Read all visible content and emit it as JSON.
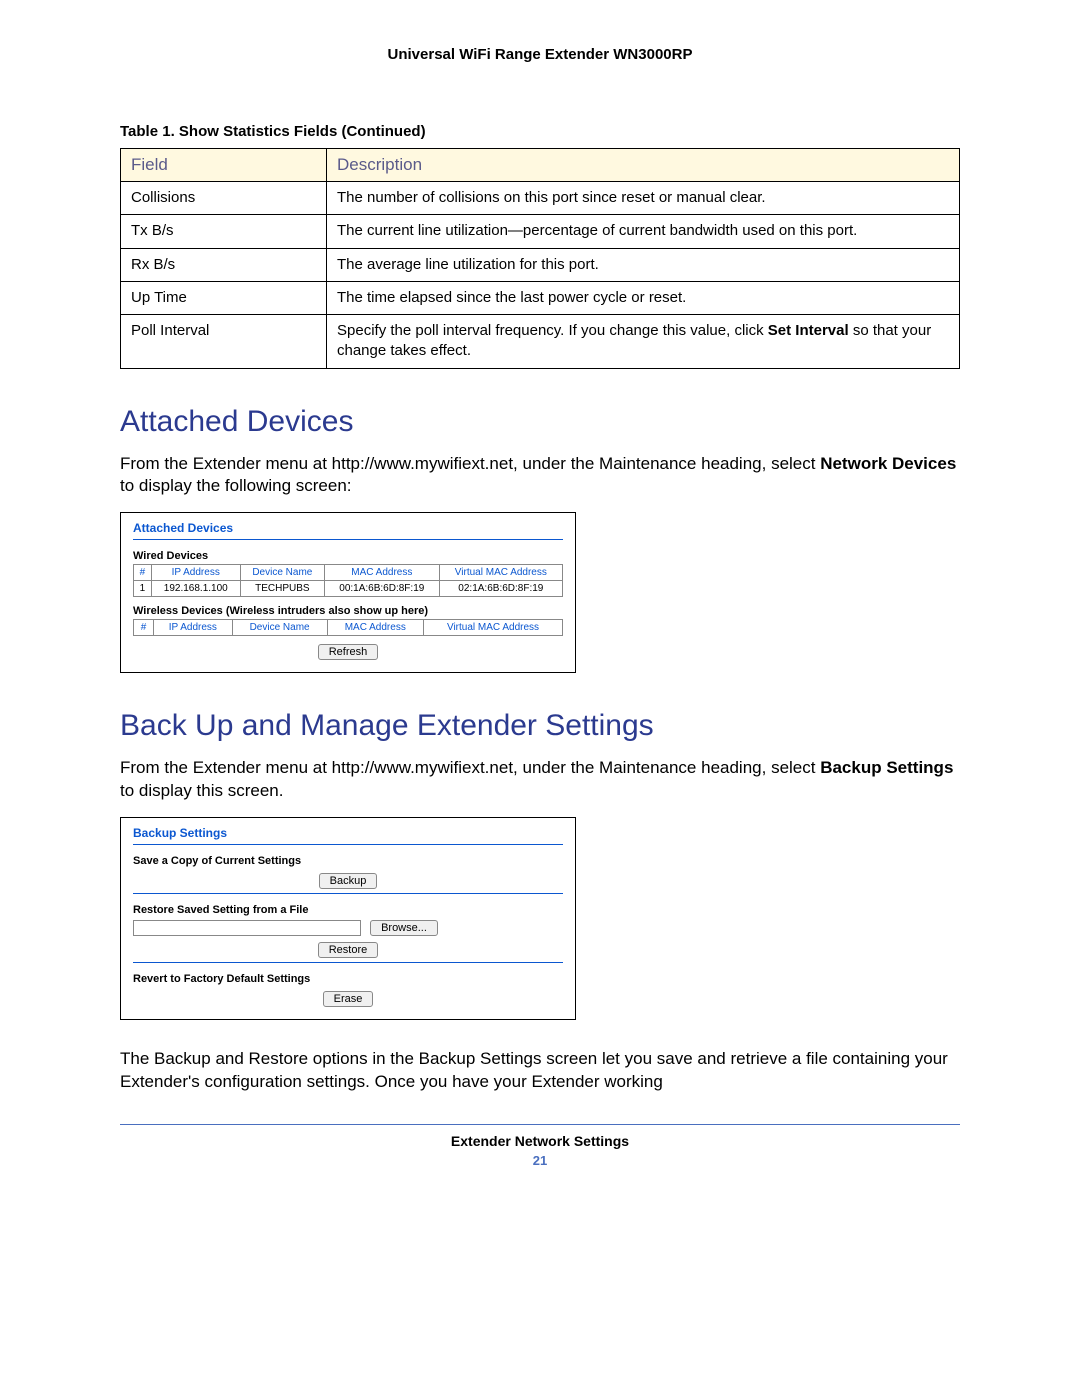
{
  "header": "Universal WiFi Range Extender WN3000RP",
  "table_caption": "Table 1.  Show Statistics Fields (Continued)",
  "stats_table": {
    "head_field": "Field",
    "head_desc": "Description",
    "rows": [
      {
        "field": "Collisions",
        "desc": "The number of collisions on this port since reset or manual clear."
      },
      {
        "field": "Tx B/s",
        "desc": "The current line utilization—percentage of current bandwidth used on this port."
      },
      {
        "field": "Rx B/s",
        "desc": "The average line utilization for this port."
      },
      {
        "field": "Up Time",
        "desc": "The time elapsed since the last power cycle or reset."
      },
      {
        "field": "Poll Interval",
        "desc_prefix": "Specify the poll interval frequency. If you change this value, click ",
        "desc_bold": "Set Interval",
        "desc_suffix": " so that your change takes effect."
      }
    ]
  },
  "section1": {
    "title": "Attached Devices",
    "para_prefix": "From the Extender menu at http://www.mywifiext.net, under the Maintenance heading, select ",
    "para_bold": "Network Devices",
    "para_suffix": " to display the following screen:"
  },
  "attached_panel": {
    "title": "Attached Devices",
    "wired_label": "Wired Devices",
    "wireless_label": "Wireless Devices (Wireless intruders also show up here)",
    "cols": {
      "num": "#",
      "ip": "IP Address",
      "name": "Device Name",
      "mac": "MAC Address",
      "vmac": "Virtual MAC Address"
    },
    "wired_row": {
      "num": "1",
      "ip": "192.168.1.100",
      "name": "TECHPUBS",
      "mac": "00:1A:6B:6D:8F:19",
      "vmac": "02:1A:6B:6D:8F:19"
    },
    "refresh": "Refresh"
  },
  "section2": {
    "title": "Back Up and Manage Extender Settings",
    "para_prefix": "From the Extender menu at http://www.mywifiext.net, under the Maintenance heading, select ",
    "para_bold": "Backup Settings",
    "para_suffix": " to display this screen."
  },
  "backup_panel": {
    "title": "Backup Settings",
    "save_label": "Save a Copy of Current Settings",
    "backup_btn": "Backup",
    "restore_label": "Restore Saved Setting from a File",
    "browse_btn": "Browse...",
    "restore_btn": "Restore",
    "revert_label": "Revert to Factory Default Settings",
    "erase_btn": "Erase"
  },
  "closing_para": "The Backup and Restore options in the Backup Settings screen let you save and retrieve a file containing your Extender's configuration settings. Once you have your Extender working",
  "footer": {
    "title": "Extender Network Settings",
    "page": "21"
  }
}
